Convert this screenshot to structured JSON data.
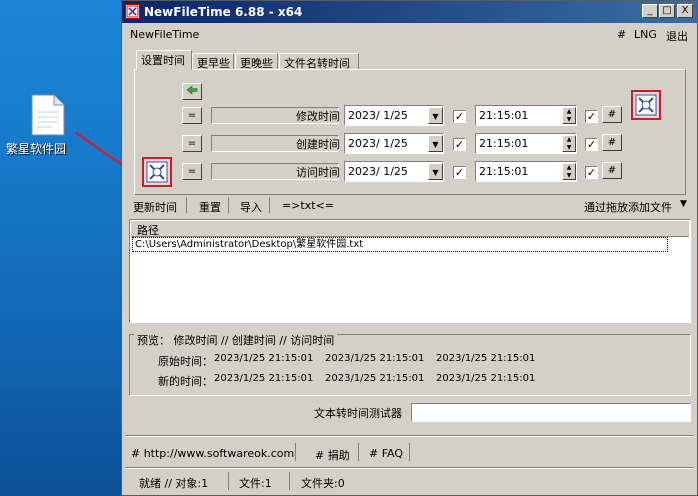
{
  "desktop": {
    "icon_label": "繁星软件园"
  },
  "window": {
    "title": "NewFileTime 6.88 - x64",
    "controls": {
      "minimize": "_",
      "maximize": "□",
      "close": "X"
    }
  },
  "menu": {
    "app_name": "NewFileTime",
    "hash": "#",
    "lng": "LNG",
    "exit": "退出"
  },
  "tabs": [
    "设置时间",
    "更早些",
    "更晚些",
    "文件名转时间"
  ],
  "time_rows": [
    {
      "label": "修改时间",
      "date": "2023/ 1/25",
      "time": "21:15:01"
    },
    {
      "label": "创建时间",
      "date": "2023/ 1/25",
      "time": "21:15:01"
    },
    {
      "label": "访问时间",
      "date": "2023/ 1/25",
      "time": "21:15:01"
    }
  ],
  "row_buttons": {
    "equals": "=",
    "hash": "#",
    "check": "✓"
  },
  "toolbar": {
    "update_time": "更新时间",
    "reset": "重置",
    "import": "导入",
    "txt": "=>txt<=",
    "drag_add": "通过拖放添加文件"
  },
  "list": {
    "column_header": "路径",
    "rows": [
      "C:\\Users\\Administrator\\Desktop\\繁星软件园.txt"
    ]
  },
  "preview": {
    "legend": "预览： 修改时间 // 创建时间 // 访问时间",
    "original_label": "原始时间：",
    "new_label": "新的时间：",
    "original_values": [
      "2023/1/25 21:15:01",
      "2023/1/25 21:15:01",
      "2023/1/25 21:15:01"
    ],
    "new_values": [
      "2023/1/25 21:15:01",
      "2023/1/25 21:15:01",
      "2023/1/25 21:15:01"
    ]
  },
  "tester": {
    "label": "文本转时间测试器",
    "value": ""
  },
  "links": {
    "website": "# http://www.softwareok.com",
    "donate": "# 捐助",
    "faq": "# FAQ"
  },
  "status": {
    "ready": "就绪 // 对象:1",
    "files": "文件:1",
    "folders": "文件夹:0"
  }
}
